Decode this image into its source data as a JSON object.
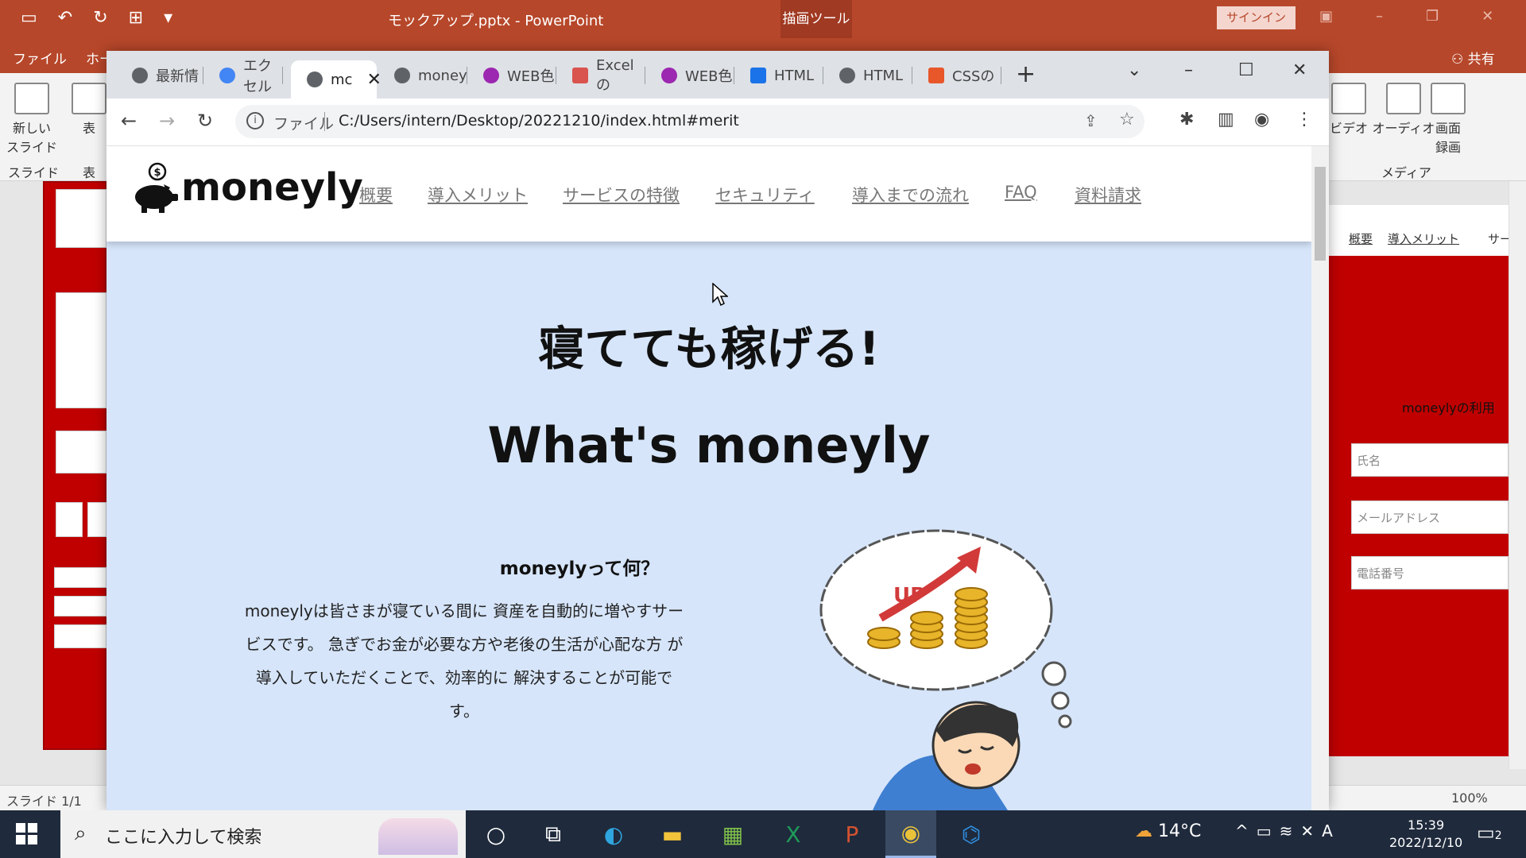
{
  "powerpoint": {
    "doc_title": "モックアップ.pptx  -  PowerPoint",
    "tools_tab": "描画ツール",
    "signin": "サインイン",
    "tab_file": "ファイル",
    "tab_home": "ホー",
    "share": "共有",
    "ribbon": {
      "new_slide": "新しい スライド",
      "table": "表",
      "video": "ビデオ",
      "audio": "オーディオ",
      "screen_record": "画面 録画",
      "group_slides": "スライド",
      "group_table": "表",
      "group_media": "メディア"
    },
    "right_pane": {
      "nav_1": "概要",
      "nav_2": "導入メリット",
      "nav_3": "サー",
      "usage": "moneylyの利用",
      "field_name": "氏名",
      "field_email": "メールアドレス",
      "field_phone": "電話番号"
    },
    "status_slide": "スライド 1/1",
    "zoom": "100%"
  },
  "browser": {
    "tabs": [
      {
        "label": "最新情",
        "favicon": "chrome",
        "color": "#5f6368"
      },
      {
        "label": "エクセル",
        "favicon": "google",
        "color": "#4285f4"
      },
      {
        "label": "mc",
        "favicon": "globe",
        "color": "#5f6368"
      },
      {
        "label": "money",
        "favicon": "globe",
        "color": "#5f6368"
      },
      {
        "label": "WEB色",
        "favicon": "palette",
        "color": "#9c27b0"
      },
      {
        "label": "Excelの",
        "favicon": "excel-red",
        "color": "#d9534f"
      },
      {
        "label": "WEB色",
        "favicon": "palette",
        "color": "#9c27b0"
      },
      {
        "label": "HTML",
        "favicon": "code",
        "color": "#1a73e8"
      },
      {
        "label": "HTML",
        "favicon": "globe",
        "color": "#5f6368"
      },
      {
        "label": "CSSの",
        "favicon": "css",
        "color": "#e8572a"
      }
    ],
    "active_tab_index": 2,
    "address_scheme": "ファイル",
    "address_url": "C:/Users/intern/Desktop/20221210/index.html#merit"
  },
  "site": {
    "brand": "moneyly",
    "nav": [
      "概要",
      "導入メリット",
      "サービスの特徴",
      "セキュリティ",
      "導入までの流れ",
      "FAQ",
      "資料請求"
    ],
    "hero_title": "寝てても稼げる!",
    "hero_subtitle": "What's moneyly",
    "what_heading": "moneylyって何？",
    "what_body": "moneylyは皆さまが寝ている間に 資産を自動的に増やすサービスです。 急ぎでお金が必要な方や老後の生活が心配な方 が導入していただくことで、効率的に 解決することが可能です。",
    "illus_up": "UP"
  },
  "taskbar": {
    "search_placeholder": "ここに入力して検索",
    "weather": "14°C",
    "time": "15:39",
    "date": "2022/12/10",
    "notifications": "2"
  }
}
